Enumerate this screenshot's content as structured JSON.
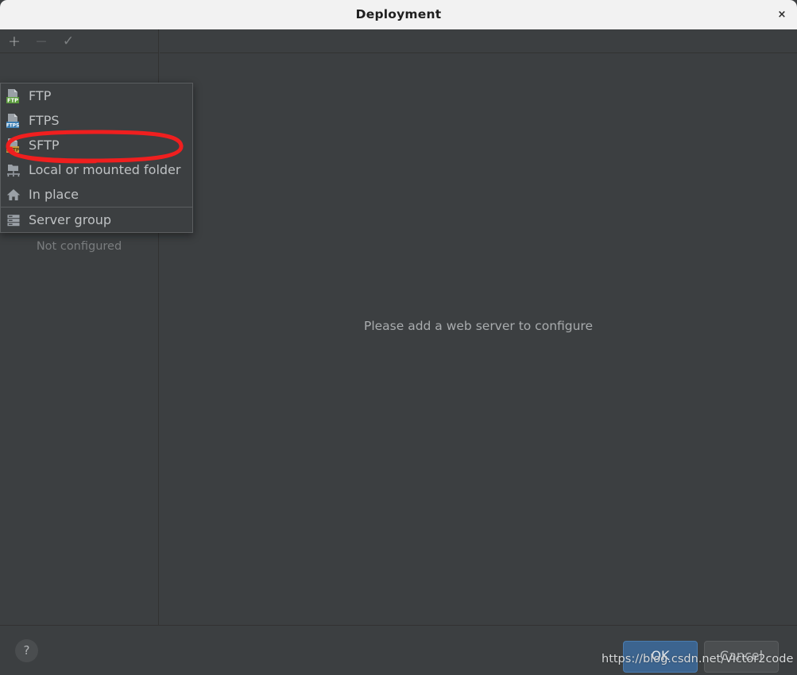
{
  "window": {
    "title": "Deployment",
    "close_icon": "close-icon",
    "close_label": "×"
  },
  "toolbar": {
    "add_label": "+",
    "add_icon": "plus-icon",
    "remove_label": "−",
    "remove_icon": "minus-icon",
    "confirm_label": "✓",
    "confirm_icon": "check-icon"
  },
  "left_pane": {
    "empty_state": "Not configured"
  },
  "right_pane": {
    "empty_state": "Please add a web server to configure"
  },
  "menu": {
    "items": [
      {
        "label": "FTP",
        "icon": "ftp-icon",
        "badge": "FTP",
        "badge_color": "#5a9a3c",
        "selected": false
      },
      {
        "label": "FTPS",
        "icon": "ftps-icon",
        "badge": "FTPS",
        "badge_color": "#3b7fb5",
        "selected": false
      },
      {
        "label": "SFTP",
        "icon": "sftp-icon",
        "badge": "SFTP",
        "badge_color": "#c89a3d",
        "selected": true
      },
      {
        "label": "Local or mounted folder",
        "icon": "mounted-folder-icon",
        "badge": "",
        "badge_color": "",
        "selected": false
      },
      {
        "label": "In place",
        "icon": "home-icon",
        "badge": "",
        "badge_color": "",
        "selected": false
      },
      {
        "label": "Server group",
        "icon": "server-group-icon",
        "badge": "",
        "badge_color": "",
        "selected": false
      }
    ],
    "separator_before_index": 5
  },
  "footer": {
    "help_label": "?",
    "help_icon": "help-icon",
    "ok_label": "OK",
    "cancel_label": "Cancel"
  },
  "annotation": {
    "shape": "red-ellipse-highlight",
    "color": "#f01f1f",
    "target": "SFTP"
  },
  "watermark": {
    "text": "https://blog.csdn.net/Victor2code"
  },
  "colors": {
    "titlebar_bg": "#f2f2f2",
    "dialog_bg": "#3c3f41",
    "text_primary": "#bfc2c4",
    "text_muted": "#7a7d7f",
    "ok_button": "#3c648f",
    "annotation_red": "#f01f1f"
  }
}
